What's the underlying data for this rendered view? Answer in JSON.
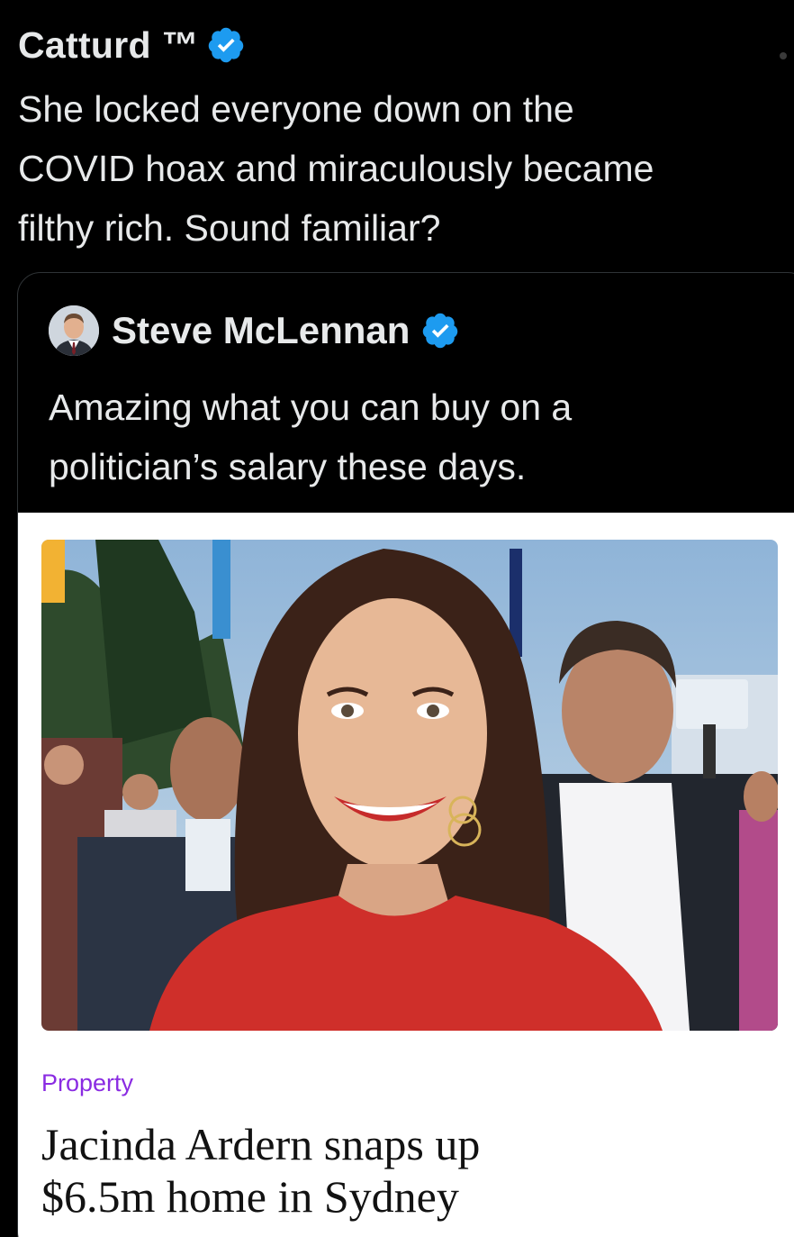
{
  "tweet": {
    "author": "Catturd ™",
    "text": "She locked everyone down on the\nCOVID hoax and miraculously became\nfilthy rich.  Sound familiar?"
  },
  "quote": {
    "author": "Steve McLennan",
    "text": "Amazing what you can buy on a\npolitician’s salary these days."
  },
  "article": {
    "category": "Property",
    "headline": "Jacinda Ardern snaps up\n$6.5m home in Sydney"
  },
  "colors": {
    "background": "#000000",
    "text": "#e7e9ea",
    "verified": "#1d9bf0",
    "category": "#8a2be2",
    "headline": "#121212"
  },
  "icons": {
    "verified": "verified-badge-icon"
  }
}
